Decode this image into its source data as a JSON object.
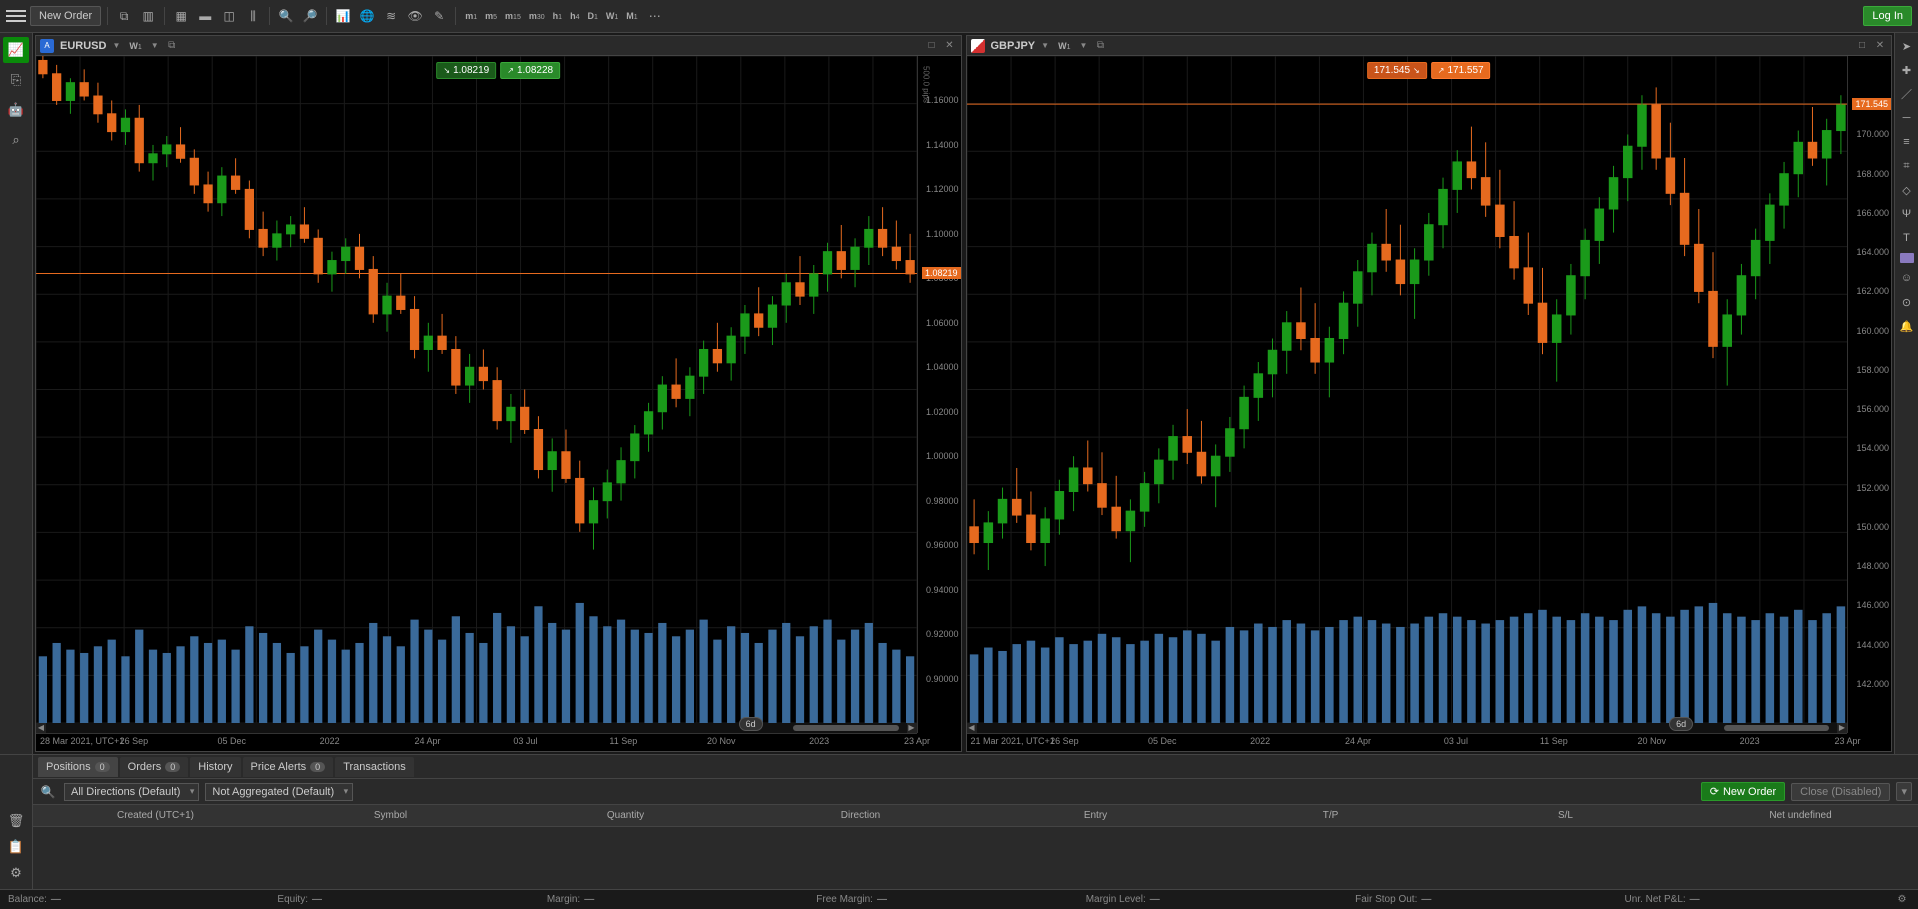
{
  "topbar": {
    "new_order": "New Order",
    "login": "Log In",
    "timeframes": [
      "m 1",
      "m 5",
      "m 15",
      "m 30",
      "h 1",
      "h 4",
      "D 1",
      "W 1",
      "M 1"
    ]
  },
  "left_chart": {
    "symbol": "EURUSD",
    "tf_label": "W",
    "tf_sub": "1",
    "sell": "1.08219",
    "buy": "1.08228",
    "price_tag": "1.08219",
    "pips_label": "500.0 pips",
    "y_ticks": [
      "1.16000",
      "1.14000",
      "1.12000",
      "1.10000",
      "1.08000",
      "1.06000",
      "1.04000",
      "1.02000",
      "1.00000",
      "0.98000",
      "0.96000",
      "0.94000",
      "0.92000",
      "0.90000"
    ],
    "x_ticks": [
      "28 Mar 2021, UTC+1",
      "26 Sep",
      "05 Dec",
      "2022",
      "24 Apr",
      "03 Jul",
      "11 Sep",
      "20 Nov",
      "2023",
      "23 Apr"
    ],
    "tz_badge": "6d"
  },
  "right_chart": {
    "symbol": "GBPJPY",
    "tf_label": "W",
    "tf_sub": "1",
    "sell": "171.545",
    "buy": "171.557",
    "price_tag": "171.545",
    "y_ticks": [
      "170.000",
      "168.000",
      "166.000",
      "164.000",
      "162.000",
      "160.000",
      "158.000",
      "156.000",
      "154.000",
      "152.000",
      "150.000",
      "148.000",
      "146.000",
      "144.000",
      "142.000"
    ],
    "x_ticks": [
      "21 Mar 2021, UTC+1",
      "26 Sep",
      "05 Dec",
      "2022",
      "24 Apr",
      "03 Jul",
      "11 Sep",
      "20 Nov",
      "2023",
      "23 Apr"
    ],
    "tz_badge": "6d"
  },
  "bottom": {
    "tabs": {
      "positions": "Positions",
      "positions_n": "0",
      "orders": "Orders",
      "orders_n": "0",
      "history": "History",
      "alerts": "Price Alerts",
      "alerts_n": "0",
      "trans": "Transactions"
    },
    "filter_dir": "All Directions (Default)",
    "filter_agg": "Not Aggregated (Default)",
    "new_order": "New Order",
    "close_disabled": "Close (Disabled)",
    "cols": [
      "Created (UTC+1)",
      "Symbol",
      "Quantity",
      "Direction",
      "Entry",
      "T/P",
      "S/L",
      "Net undefined"
    ]
  },
  "status": {
    "balance_l": "Balance:",
    "equity_l": "Equity:",
    "margin_l": "Margin:",
    "free_l": "Free Margin:",
    "level_l": "Margin Level:",
    "fair_l": "Fair Stop Out:",
    "pnl_l": "Unr. Net P&L:",
    "dash": "—"
  },
  "chart_data": [
    {
      "type": "candlestick",
      "symbol": "EURUSD",
      "timeframe": "W1",
      "ylim": [
        0.88,
        1.18
      ],
      "price_line": 1.08219,
      "x_labels": [
        "28 Mar 2021",
        "26 Sep",
        "05 Dec",
        "2022",
        "24 Apr",
        "03 Jul",
        "11 Sep",
        "20 Nov",
        "2023",
        "23 Apr"
      ],
      "candles": [
        {
          "o": 1.178,
          "h": 1.182,
          "l": 1.17,
          "c": 1.172,
          "v": 20
        },
        {
          "o": 1.172,
          "h": 1.176,
          "l": 1.158,
          "c": 1.16,
          "v": 24
        },
        {
          "o": 1.16,
          "h": 1.17,
          "l": 1.154,
          "c": 1.168,
          "v": 22
        },
        {
          "o": 1.168,
          "h": 1.174,
          "l": 1.16,
          "c": 1.162,
          "v": 21
        },
        {
          "o": 1.162,
          "h": 1.168,
          "l": 1.15,
          "c": 1.154,
          "v": 23
        },
        {
          "o": 1.154,
          "h": 1.16,
          "l": 1.142,
          "c": 1.146,
          "v": 25
        },
        {
          "o": 1.146,
          "h": 1.156,
          "l": 1.14,
          "c": 1.152,
          "v": 20
        },
        {
          "o": 1.152,
          "h": 1.158,
          "l": 1.128,
          "c": 1.132,
          "v": 28
        },
        {
          "o": 1.132,
          "h": 1.14,
          "l": 1.124,
          "c": 1.136,
          "v": 22
        },
        {
          "o": 1.136,
          "h": 1.144,
          "l": 1.13,
          "c": 1.14,
          "v": 21
        },
        {
          "o": 1.14,
          "h": 1.148,
          "l": 1.132,
          "c": 1.134,
          "v": 23
        },
        {
          "o": 1.134,
          "h": 1.138,
          "l": 1.118,
          "c": 1.122,
          "v": 26
        },
        {
          "o": 1.122,
          "h": 1.128,
          "l": 1.11,
          "c": 1.114,
          "v": 24
        },
        {
          "o": 1.114,
          "h": 1.13,
          "l": 1.108,
          "c": 1.126,
          "v": 25
        },
        {
          "o": 1.126,
          "h": 1.134,
          "l": 1.118,
          "c": 1.12,
          "v": 22
        },
        {
          "o": 1.12,
          "h": 1.124,
          "l": 1.098,
          "c": 1.102,
          "v": 29
        },
        {
          "o": 1.102,
          "h": 1.11,
          "l": 1.09,
          "c": 1.094,
          "v": 27
        },
        {
          "o": 1.094,
          "h": 1.106,
          "l": 1.088,
          "c": 1.1,
          "v": 24
        },
        {
          "o": 1.1,
          "h": 1.108,
          "l": 1.094,
          "c": 1.104,
          "v": 21
        },
        {
          "o": 1.104,
          "h": 1.112,
          "l": 1.096,
          "c": 1.098,
          "v": 23
        },
        {
          "o": 1.098,
          "h": 1.102,
          "l": 1.078,
          "c": 1.082,
          "v": 28
        },
        {
          "o": 1.082,
          "h": 1.092,
          "l": 1.074,
          "c": 1.088,
          "v": 25
        },
        {
          "o": 1.088,
          "h": 1.098,
          "l": 1.082,
          "c": 1.094,
          "v": 22
        },
        {
          "o": 1.094,
          "h": 1.1,
          "l": 1.08,
          "c": 1.084,
          "v": 24
        },
        {
          "o": 1.084,
          "h": 1.09,
          "l": 1.06,
          "c": 1.064,
          "v": 30
        },
        {
          "o": 1.064,
          "h": 1.078,
          "l": 1.056,
          "c": 1.072,
          "v": 26
        },
        {
          "o": 1.072,
          "h": 1.082,
          "l": 1.064,
          "c": 1.066,
          "v": 23
        },
        {
          "o": 1.066,
          "h": 1.072,
          "l": 1.044,
          "c": 1.048,
          "v": 31
        },
        {
          "o": 1.048,
          "h": 1.06,
          "l": 1.038,
          "c": 1.054,
          "v": 28
        },
        {
          "o": 1.054,
          "h": 1.064,
          "l": 1.046,
          "c": 1.048,
          "v": 25
        },
        {
          "o": 1.048,
          "h": 1.054,
          "l": 1.028,
          "c": 1.032,
          "v": 32
        },
        {
          "o": 1.032,
          "h": 1.046,
          "l": 1.024,
          "c": 1.04,
          "v": 27
        },
        {
          "o": 1.04,
          "h": 1.048,
          "l": 1.03,
          "c": 1.034,
          "v": 24
        },
        {
          "o": 1.034,
          "h": 1.04,
          "l": 1.012,
          "c": 1.016,
          "v": 33
        },
        {
          "o": 1.016,
          "h": 1.028,
          "l": 1.006,
          "c": 1.022,
          "v": 29
        },
        {
          "o": 1.022,
          "h": 1.03,
          "l": 1.01,
          "c": 1.012,
          "v": 26
        },
        {
          "o": 1.012,
          "h": 1.018,
          "l": 0.99,
          "c": 0.994,
          "v": 35
        },
        {
          "o": 0.994,
          "h": 1.008,
          "l": 0.984,
          "c": 1.002,
          "v": 30
        },
        {
          "o": 1.002,
          "h": 1.012,
          "l": 0.988,
          "c": 0.99,
          "v": 28
        },
        {
          "o": 0.99,
          "h": 0.998,
          "l": 0.966,
          "c": 0.97,
          "v": 36
        },
        {
          "o": 0.97,
          "h": 0.986,
          "l": 0.958,
          "c": 0.98,
          "v": 32
        },
        {
          "o": 0.98,
          "h": 0.994,
          "l": 0.972,
          "c": 0.988,
          "v": 29
        },
        {
          "o": 0.988,
          "h": 1.004,
          "l": 0.98,
          "c": 0.998,
          "v": 31
        },
        {
          "o": 0.998,
          "h": 1.014,
          "l": 0.99,
          "c": 1.01,
          "v": 28
        },
        {
          "o": 1.01,
          "h": 1.024,
          "l": 1.002,
          "c": 1.02,
          "v": 27
        },
        {
          "o": 1.02,
          "h": 1.036,
          "l": 1.012,
          "c": 1.032,
          "v": 30
        },
        {
          "o": 1.032,
          "h": 1.044,
          "l": 1.022,
          "c": 1.026,
          "v": 26
        },
        {
          "o": 1.026,
          "h": 1.04,
          "l": 1.018,
          "c": 1.036,
          "v": 28
        },
        {
          "o": 1.036,
          "h": 1.052,
          "l": 1.028,
          "c": 1.048,
          "v": 31
        },
        {
          "o": 1.048,
          "h": 1.06,
          "l": 1.038,
          "c": 1.042,
          "v": 25
        },
        {
          "o": 1.042,
          "h": 1.058,
          "l": 1.034,
          "c": 1.054,
          "v": 29
        },
        {
          "o": 1.054,
          "h": 1.068,
          "l": 1.046,
          "c": 1.064,
          "v": 27
        },
        {
          "o": 1.064,
          "h": 1.076,
          "l": 1.054,
          "c": 1.058,
          "v": 24
        },
        {
          "o": 1.058,
          "h": 1.072,
          "l": 1.05,
          "c": 1.068,
          "v": 28
        },
        {
          "o": 1.068,
          "h": 1.082,
          "l": 1.06,
          "c": 1.078,
          "v": 30
        },
        {
          "o": 1.078,
          "h": 1.09,
          "l": 1.068,
          "c": 1.072,
          "v": 26
        },
        {
          "o": 1.072,
          "h": 1.086,
          "l": 1.064,
          "c": 1.082,
          "v": 29
        },
        {
          "o": 1.082,
          "h": 1.096,
          "l": 1.074,
          "c": 1.092,
          "v": 31
        },
        {
          "o": 1.092,
          "h": 1.104,
          "l": 1.08,
          "c": 1.084,
          "v": 25
        },
        {
          "o": 1.084,
          "h": 1.098,
          "l": 1.076,
          "c": 1.094,
          "v": 28
        },
        {
          "o": 1.094,
          "h": 1.108,
          "l": 1.086,
          "c": 1.102,
          "v": 30
        },
        {
          "o": 1.102,
          "h": 1.112,
          "l": 1.09,
          "c": 1.094,
          "v": 24
        },
        {
          "o": 1.094,
          "h": 1.106,
          "l": 1.084,
          "c": 1.088,
          "v": 22
        },
        {
          "o": 1.088,
          "h": 1.1,
          "l": 1.078,
          "c": 1.082,
          "v": 20
        }
      ]
    },
    {
      "type": "candlestick",
      "symbol": "GBPJPY",
      "timeframe": "W1",
      "ylim": [
        140,
        174
      ],
      "price_line": 171.545,
      "x_labels": [
        "21 Mar 2021",
        "26 Sep",
        "05 Dec",
        "2022",
        "24 Apr",
        "03 Jul",
        "11 Sep",
        "20 Nov",
        "2023",
        "23 Apr"
      ],
      "candles": [
        {
          "o": 150.0,
          "h": 151.4,
          "l": 148.6,
          "c": 149.2,
          "v": 20
        },
        {
          "o": 149.2,
          "h": 150.8,
          "l": 147.8,
          "c": 150.2,
          "v": 22
        },
        {
          "o": 150.2,
          "h": 152.0,
          "l": 149.4,
          "c": 151.4,
          "v": 21
        },
        {
          "o": 151.4,
          "h": 153.0,
          "l": 150.2,
          "c": 150.6,
          "v": 23
        },
        {
          "o": 150.6,
          "h": 151.8,
          "l": 148.8,
          "c": 149.2,
          "v": 24
        },
        {
          "o": 149.2,
          "h": 151.0,
          "l": 148.0,
          "c": 150.4,
          "v": 22
        },
        {
          "o": 150.4,
          "h": 152.4,
          "l": 149.6,
          "c": 151.8,
          "v": 25
        },
        {
          "o": 151.8,
          "h": 153.6,
          "l": 150.8,
          "c": 153.0,
          "v": 23
        },
        {
          "o": 153.0,
          "h": 154.4,
          "l": 151.8,
          "c": 152.2,
          "v": 24
        },
        {
          "o": 152.2,
          "h": 153.8,
          "l": 150.6,
          "c": 151.0,
          "v": 26
        },
        {
          "o": 151.0,
          "h": 152.6,
          "l": 149.4,
          "c": 149.8,
          "v": 25
        },
        {
          "o": 149.8,
          "h": 151.4,
          "l": 148.2,
          "c": 150.8,
          "v": 23
        },
        {
          "o": 150.8,
          "h": 152.8,
          "l": 150.0,
          "c": 152.2,
          "v": 24
        },
        {
          "o": 152.2,
          "h": 154.0,
          "l": 151.2,
          "c": 153.4,
          "v": 26
        },
        {
          "o": 153.4,
          "h": 155.2,
          "l": 152.4,
          "c": 154.6,
          "v": 25
        },
        {
          "o": 154.6,
          "h": 156.0,
          "l": 153.2,
          "c": 153.8,
          "v": 27
        },
        {
          "o": 153.8,
          "h": 155.4,
          "l": 152.2,
          "c": 152.6,
          "v": 26
        },
        {
          "o": 152.6,
          "h": 154.2,
          "l": 151.0,
          "c": 153.6,
          "v": 24
        },
        {
          "o": 153.6,
          "h": 155.6,
          "l": 152.8,
          "c": 155.0,
          "v": 28
        },
        {
          "o": 155.0,
          "h": 157.2,
          "l": 154.0,
          "c": 156.6,
          "v": 27
        },
        {
          "o": 156.6,
          "h": 158.4,
          "l": 155.4,
          "c": 157.8,
          "v": 29
        },
        {
          "o": 157.8,
          "h": 159.6,
          "l": 156.6,
          "c": 159.0,
          "v": 28
        },
        {
          "o": 159.0,
          "h": 161.0,
          "l": 157.8,
          "c": 160.4,
          "v": 30
        },
        {
          "o": 160.4,
          "h": 162.2,
          "l": 159.0,
          "c": 159.6,
          "v": 29
        },
        {
          "o": 159.6,
          "h": 161.4,
          "l": 157.8,
          "c": 158.4,
          "v": 27
        },
        {
          "o": 158.4,
          "h": 160.2,
          "l": 156.6,
          "c": 159.6,
          "v": 28
        },
        {
          "o": 159.6,
          "h": 162.0,
          "l": 158.8,
          "c": 161.4,
          "v": 30
        },
        {
          "o": 161.4,
          "h": 163.6,
          "l": 160.2,
          "c": 163.0,
          "v": 31
        },
        {
          "o": 163.0,
          "h": 165.0,
          "l": 161.8,
          "c": 164.4,
          "v": 30
        },
        {
          "o": 164.4,
          "h": 166.2,
          "l": 163.0,
          "c": 163.6,
          "v": 29
        },
        {
          "o": 163.6,
          "h": 165.4,
          "l": 161.8,
          "c": 162.4,
          "v": 28
        },
        {
          "o": 162.4,
          "h": 164.2,
          "l": 160.6,
          "c": 163.6,
          "v": 29
        },
        {
          "o": 163.6,
          "h": 166.0,
          "l": 162.8,
          "c": 165.4,
          "v": 31
        },
        {
          "o": 165.4,
          "h": 167.8,
          "l": 164.2,
          "c": 167.2,
          "v": 32
        },
        {
          "o": 167.2,
          "h": 169.2,
          "l": 166.0,
          "c": 168.6,
          "v": 31
        },
        {
          "o": 168.6,
          "h": 170.4,
          "l": 167.2,
          "c": 167.8,
          "v": 30
        },
        {
          "o": 167.8,
          "h": 169.6,
          "l": 165.8,
          "c": 166.4,
          "v": 29
        },
        {
          "o": 166.4,
          "h": 168.2,
          "l": 164.2,
          "c": 164.8,
          "v": 30
        },
        {
          "o": 164.8,
          "h": 166.6,
          "l": 162.6,
          "c": 163.2,
          "v": 31
        },
        {
          "o": 163.2,
          "h": 165.0,
          "l": 160.8,
          "c": 161.4,
          "v": 32
        },
        {
          "o": 161.4,
          "h": 163.2,
          "l": 158.8,
          "c": 159.4,
          "v": 33
        },
        {
          "o": 159.4,
          "h": 161.6,
          "l": 157.4,
          "c": 160.8,
          "v": 31
        },
        {
          "o": 160.8,
          "h": 163.4,
          "l": 159.8,
          "c": 162.8,
          "v": 30
        },
        {
          "o": 162.8,
          "h": 165.2,
          "l": 161.6,
          "c": 164.6,
          "v": 32
        },
        {
          "o": 164.6,
          "h": 166.8,
          "l": 163.4,
          "c": 166.2,
          "v": 31
        },
        {
          "o": 166.2,
          "h": 168.4,
          "l": 165.0,
          "c": 167.8,
          "v": 30
        },
        {
          "o": 167.8,
          "h": 170.0,
          "l": 166.6,
          "c": 169.4,
          "v": 33
        },
        {
          "o": 169.4,
          "h": 172.0,
          "l": 168.2,
          "c": 171.5,
          "v": 34
        },
        {
          "o": 171.5,
          "h": 172.4,
          "l": 168.2,
          "c": 168.8,
          "v": 32
        },
        {
          "o": 168.8,
          "h": 170.6,
          "l": 166.4,
          "c": 167.0,
          "v": 31
        },
        {
          "o": 167.0,
          "h": 168.8,
          "l": 163.8,
          "c": 164.4,
          "v": 33
        },
        {
          "o": 164.4,
          "h": 166.2,
          "l": 161.4,
          "c": 162.0,
          "v": 34
        },
        {
          "o": 162.0,
          "h": 164.0,
          "l": 158.6,
          "c": 159.2,
          "v": 35
        },
        {
          "o": 159.2,
          "h": 161.6,
          "l": 157.2,
          "c": 160.8,
          "v": 32
        },
        {
          "o": 160.8,
          "h": 163.4,
          "l": 159.8,
          "c": 162.8,
          "v": 31
        },
        {
          "o": 162.8,
          "h": 165.2,
          "l": 161.6,
          "c": 164.6,
          "v": 30
        },
        {
          "o": 164.6,
          "h": 167.0,
          "l": 163.4,
          "c": 166.4,
          "v": 32
        },
        {
          "o": 166.4,
          "h": 168.6,
          "l": 165.2,
          "c": 168.0,
          "v": 31
        },
        {
          "o": 168.0,
          "h": 170.2,
          "l": 166.8,
          "c": 169.6,
          "v": 33
        },
        {
          "o": 169.6,
          "h": 171.4,
          "l": 168.4,
          "c": 168.8,
          "v": 30
        },
        {
          "o": 168.8,
          "h": 170.8,
          "l": 167.4,
          "c": 170.2,
          "v": 32
        },
        {
          "o": 170.2,
          "h": 172.0,
          "l": 169.0,
          "c": 171.5,
          "v": 34
        }
      ]
    }
  ]
}
